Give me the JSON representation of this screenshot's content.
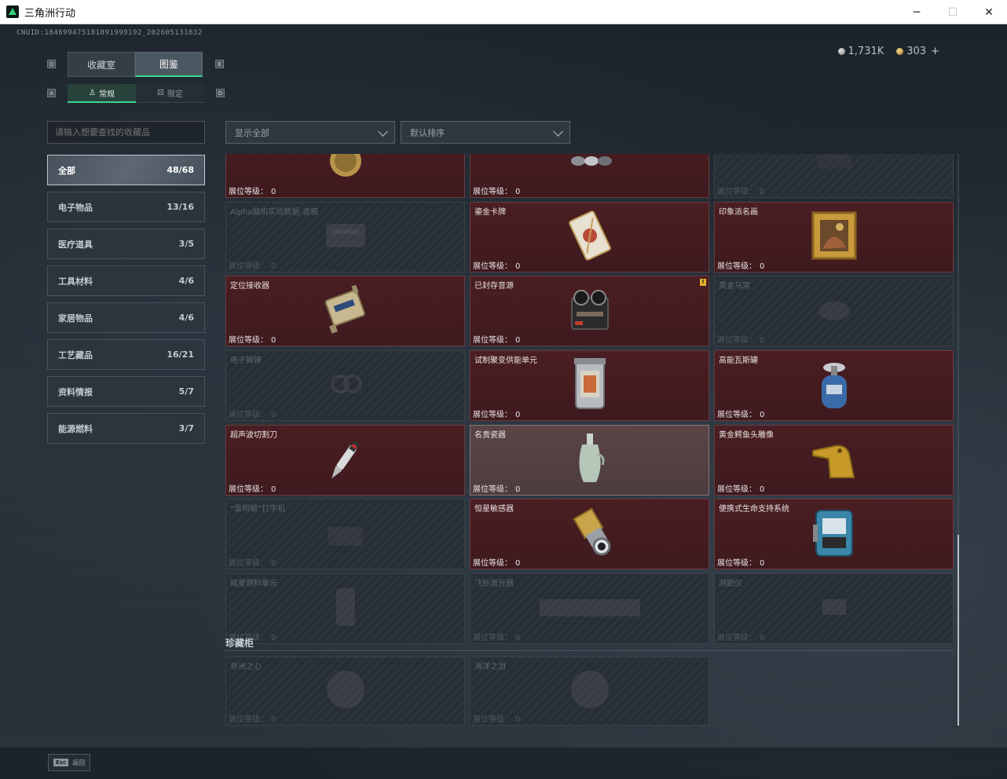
{
  "window": {
    "title": "三角洲行动",
    "minimize": "─",
    "maximize": "☐",
    "close": "✕"
  },
  "uid": "CNUID:184699475181891999192_202605131832",
  "currency": {
    "silver": "1,731K",
    "gold": "303",
    "plus": "+"
  },
  "main_tabs": [
    {
      "label": "收藏室"
    },
    {
      "label": "图鉴"
    }
  ],
  "sub_tabs": [
    {
      "label": "常规"
    },
    {
      "label": "限定"
    }
  ],
  "search": {
    "placeholder": "请输入想要查找的收藏品"
  },
  "filter": {
    "selected": "显示全部"
  },
  "sort": {
    "selected": "默认排序"
  },
  "categories": [
    {
      "label": "全部",
      "count": "48/68"
    },
    {
      "label": "电子物品",
      "count": "13/16"
    },
    {
      "label": "医疗道具",
      "count": "3/5"
    },
    {
      "label": "工具材料",
      "count": "4/6"
    },
    {
      "label": "家居物品",
      "count": "4/6"
    },
    {
      "label": "工艺藏品",
      "count": "16/21"
    },
    {
      "label": "资料情报",
      "count": "5/7"
    },
    {
      "label": "能源燃料",
      "count": "3/7"
    }
  ],
  "level_label": "展位等级：",
  "items": [
    {
      "name": "",
      "level": "0",
      "state": "owned",
      "icon": "coin-icon"
    },
    {
      "name": "",
      "level": "0",
      "state": "owned",
      "icon": "chain-icon"
    },
    {
      "name": "",
      "level": "0",
      "state": "locked",
      "icon": "generic-icon"
    },
    {
      "name": "Alpha脑机实验数据-遗稿",
      "level": "0",
      "state": "locked",
      "icon": "data-drive-icon"
    },
    {
      "name": "鎏金卡牌",
      "level": "0",
      "state": "owned",
      "icon": "card-icon"
    },
    {
      "name": "印象派名画",
      "level": "0",
      "state": "owned",
      "icon": "painting-icon"
    },
    {
      "name": "定位接收器",
      "level": "0",
      "state": "owned",
      "icon": "receiver-icon"
    },
    {
      "name": "已封存音源",
      "level": "0",
      "state": "owned",
      "icon": "tape-recorder-icon",
      "warn": "!"
    },
    {
      "name": "黄金乌窝",
      "level": "0",
      "state": "locked",
      "icon": "nest-icon"
    },
    {
      "name": "电子脚镣",
      "level": "0",
      "state": "locked",
      "icon": "shackle-icon"
    },
    {
      "name": "试制聚变供能单元",
      "level": "0",
      "state": "owned",
      "icon": "fusion-cell-icon"
    },
    {
      "name": "高能瓦斯罐",
      "level": "0",
      "state": "owned",
      "icon": "gas-canister-icon"
    },
    {
      "name": "超声波切割刀",
      "level": "0",
      "state": "owned",
      "icon": "cutter-icon"
    },
    {
      "name": "名贵瓷器",
      "level": "0",
      "state": "highlight",
      "icon": "vase-icon"
    },
    {
      "name": "黄金鳄鱼头雕像",
      "level": "0",
      "state": "owned",
      "icon": "croc-statue-icon"
    },
    {
      "name": "“雷明顿”打字机",
      "level": "0",
      "state": "locked",
      "icon": "typewriter-icon"
    },
    {
      "name": "恒星敏感器",
      "level": "0",
      "state": "owned",
      "icon": "star-sensor-icon"
    },
    {
      "name": "便携式生命支持系统",
      "level": "0",
      "state": "owned",
      "icon": "life-support-icon"
    },
    {
      "name": "暗星燃料单元",
      "level": "0",
      "state": "locked",
      "icon": "fuel-cell-icon"
    },
    {
      "name": "飞秒激光器",
      "level": "0",
      "state": "locked",
      "icon": "laser-icon"
    },
    {
      "name": "测距仪",
      "level": "0",
      "state": "locked",
      "icon": "rangefinder-icon"
    }
  ],
  "cabinet": {
    "title": "珍藏柜",
    "items": [
      {
        "name": "非洲之心",
        "level": "0",
        "state": "locked",
        "icon": "gem-icon"
      },
      {
        "name": "海洋之泪",
        "level": "0",
        "state": "locked",
        "icon": "gem-icon"
      }
    ]
  },
  "footer": {
    "esc_key": "Esc",
    "esc_label": "返回"
  },
  "colors": {
    "accent": "#39d98a",
    "owned_bg": "#4a1e22",
    "locked_bg": "#262d34",
    "warn": "#e6b22a"
  }
}
